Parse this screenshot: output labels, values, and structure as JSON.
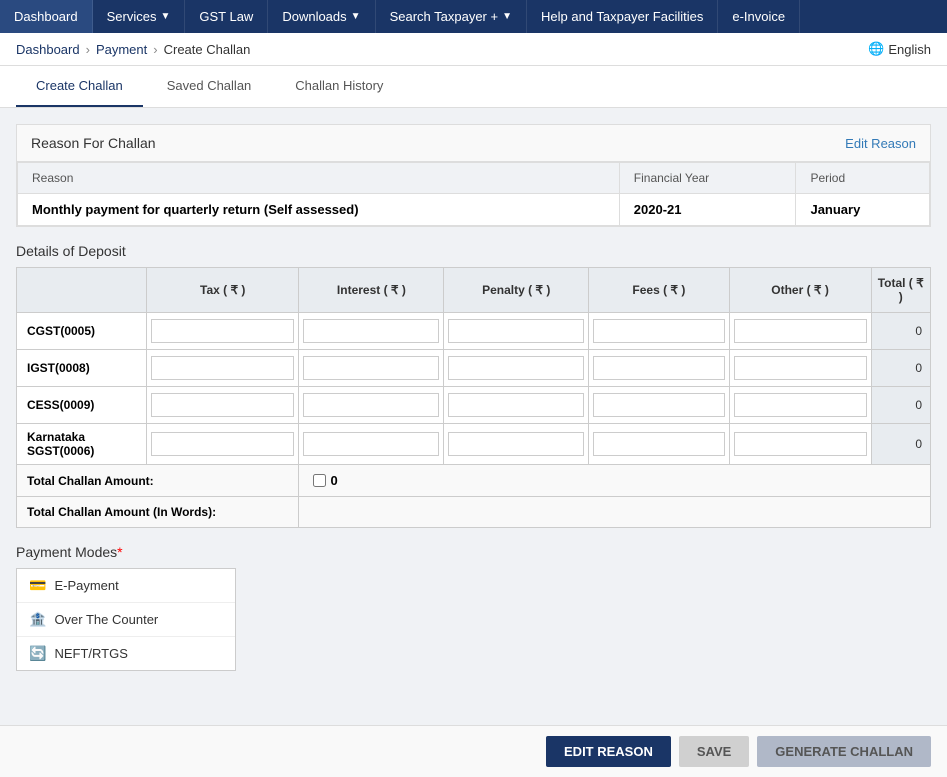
{
  "nav": {
    "items": [
      {
        "id": "dashboard",
        "label": "Dashboard",
        "active": true,
        "hasArrow": false
      },
      {
        "id": "services",
        "label": "Services",
        "active": false,
        "hasArrow": true
      },
      {
        "id": "gst-law",
        "label": "GST Law",
        "active": false,
        "hasArrow": false
      },
      {
        "id": "downloads",
        "label": "Downloads",
        "active": false,
        "hasArrow": true
      },
      {
        "id": "search-taxpayer",
        "label": "Search Taxpayer +",
        "active": false,
        "hasArrow": true
      },
      {
        "id": "help",
        "label": "Help and Taxpayer Facilities",
        "active": false,
        "hasArrow": false
      },
      {
        "id": "e-invoice",
        "label": "e-Invoice",
        "active": false,
        "hasArrow": false
      }
    ]
  },
  "breadcrumb": {
    "items": [
      {
        "label": "Dashboard",
        "link": true
      },
      {
        "label": "Payment",
        "link": true
      },
      {
        "label": "Create Challan",
        "link": false
      }
    ]
  },
  "language": {
    "label": "English"
  },
  "tabs": [
    {
      "id": "create-challan",
      "label": "Create Challan",
      "active": true
    },
    {
      "id": "saved-challan",
      "label": "Saved Challan",
      "active": false
    },
    {
      "id": "challan-history",
      "label": "Challan History",
      "active": false
    }
  ],
  "reason_section": {
    "title": "Reason For Challan",
    "edit_link": "Edit Reason",
    "columns": [
      "Reason",
      "Financial Year",
      "Period"
    ],
    "row": {
      "reason": "Monthly payment for quarterly return (Self assessed)",
      "financial_year": "2020-21",
      "period": "January"
    }
  },
  "deposit_section": {
    "title": "Details of Deposit",
    "columns": [
      "",
      "Tax ( ₹ )",
      "Interest ( ₹ )",
      "Penalty ( ₹ )",
      "Fees ( ₹ )",
      "Other ( ₹ )",
      "Total ( ₹ )"
    ],
    "rows": [
      {
        "label": "CGST(0005)",
        "total": "0"
      },
      {
        "label": "IGST(0008)",
        "total": "0"
      },
      {
        "label": "CESS(0009)",
        "total": "0"
      },
      {
        "label": "Karnataka SGST(0006)",
        "total": "0"
      }
    ],
    "total_row": {
      "label": "Total Challan Amount:",
      "value": "0"
    },
    "words_row": {
      "label": "Total Challan Amount (In Words):",
      "value": ""
    }
  },
  "payment_modes": {
    "title": "Payment Modes",
    "required": true,
    "options": [
      {
        "id": "e-payment",
        "label": "E-Payment",
        "icon": "💳"
      },
      {
        "id": "over-the-counter",
        "label": "Over The Counter",
        "icon": "🏦"
      },
      {
        "id": "neft-rtgs",
        "label": "NEFT/RTGS",
        "icon": "🔄"
      }
    ]
  },
  "buttons": {
    "edit_reason": "EDIT REASON",
    "save": "SAVE",
    "generate_challan": "GENERATE CHALLAN"
  }
}
